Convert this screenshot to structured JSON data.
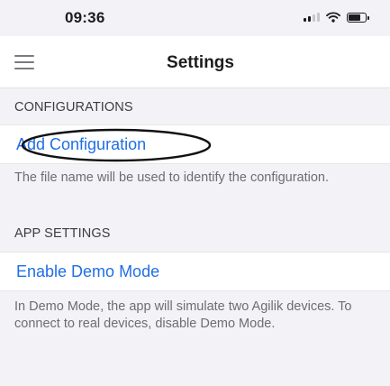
{
  "status_bar": {
    "time": "09:36",
    "icons": [
      "signal-icon",
      "wifi-icon",
      "battery-icon"
    ],
    "battery_level": 0.75
  },
  "nav": {
    "title": "Settings",
    "menu_icon": "hamburger-menu-icon"
  },
  "configurations": {
    "header": "CONFIGURATIONS",
    "add_label": "Add Configuration",
    "footer": "The file name will be used to identify the configuration."
  },
  "app_settings": {
    "header": "APP SETTINGS",
    "demo_label": "Enable Demo Mode",
    "footer": "In Demo Mode, the app will simulate two Agilik devices. To connect to real devices, disable Demo Mode."
  },
  "colors": {
    "accent": "#1f6fe5",
    "background": "#f2f2f7",
    "annotation": "#111111"
  }
}
